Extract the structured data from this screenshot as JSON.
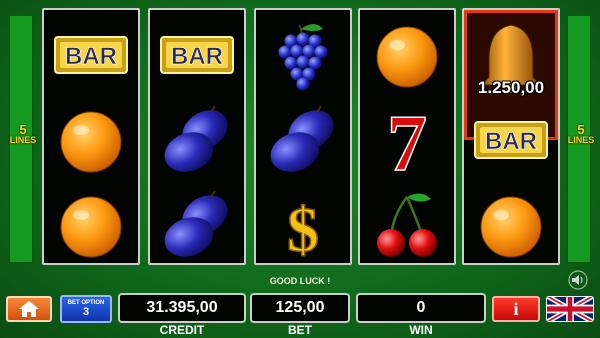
{
  "lines": {
    "count": "5",
    "word": "LINES"
  },
  "reels": [
    [
      "bar",
      "orange",
      "orange"
    ],
    [
      "bar",
      "plum",
      "plum"
    ],
    [
      "grapes",
      "plum",
      "dollar"
    ],
    [
      "orange",
      "seven",
      "cherry"
    ],
    [
      "bell",
      "bar",
      "orange"
    ]
  ],
  "symbol_text": {
    "bar": "BAR",
    "seven": "7",
    "dollar": "$"
  },
  "win_highlight": {
    "reel": 5,
    "amount": "1.250,00"
  },
  "message": "GOOD LUCK !",
  "bet_option": {
    "label": "BET OPTION",
    "value": "3"
  },
  "credit": {
    "value": "31.395,00",
    "label": "CREDIT"
  },
  "bet": {
    "value": "125,00",
    "label": "BET"
  },
  "win": {
    "value": "0",
    "label": "WIN"
  },
  "info_label": "i",
  "icons": {
    "home": "home-icon",
    "sound": "speaker-icon",
    "language": "uk-flag-icon",
    "info": "info-icon"
  },
  "colors": {
    "table": "#106a1c",
    "reel_bg": "#020402",
    "lines_text": "#ffd21a",
    "home_button": "#e8621a",
    "bet_option_button": "#1346c8",
    "info_button": "#e01010",
    "win_frame": "#e23a10"
  }
}
